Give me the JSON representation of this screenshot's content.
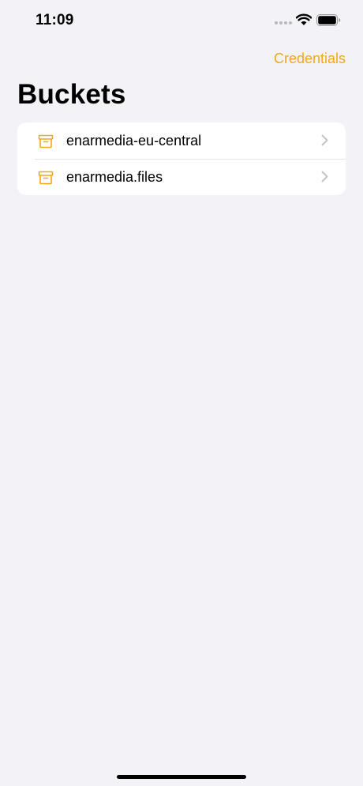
{
  "status_bar": {
    "time": "11:09",
    "icons": [
      "signal-icon",
      "wifi-icon",
      "battery-icon"
    ]
  },
  "nav": {
    "action_label": "Credentials"
  },
  "page": {
    "title": "Buckets"
  },
  "buckets": [
    {
      "name": "enarmedia-eu-central",
      "icon": "archive-box-icon"
    },
    {
      "name": "enarmedia.files",
      "icon": "archive-box-icon"
    }
  ],
  "colors": {
    "accent": "#f2a71c",
    "background": "#f2f2f7",
    "card": "#ffffff",
    "chevron": "#c4c4c7"
  }
}
